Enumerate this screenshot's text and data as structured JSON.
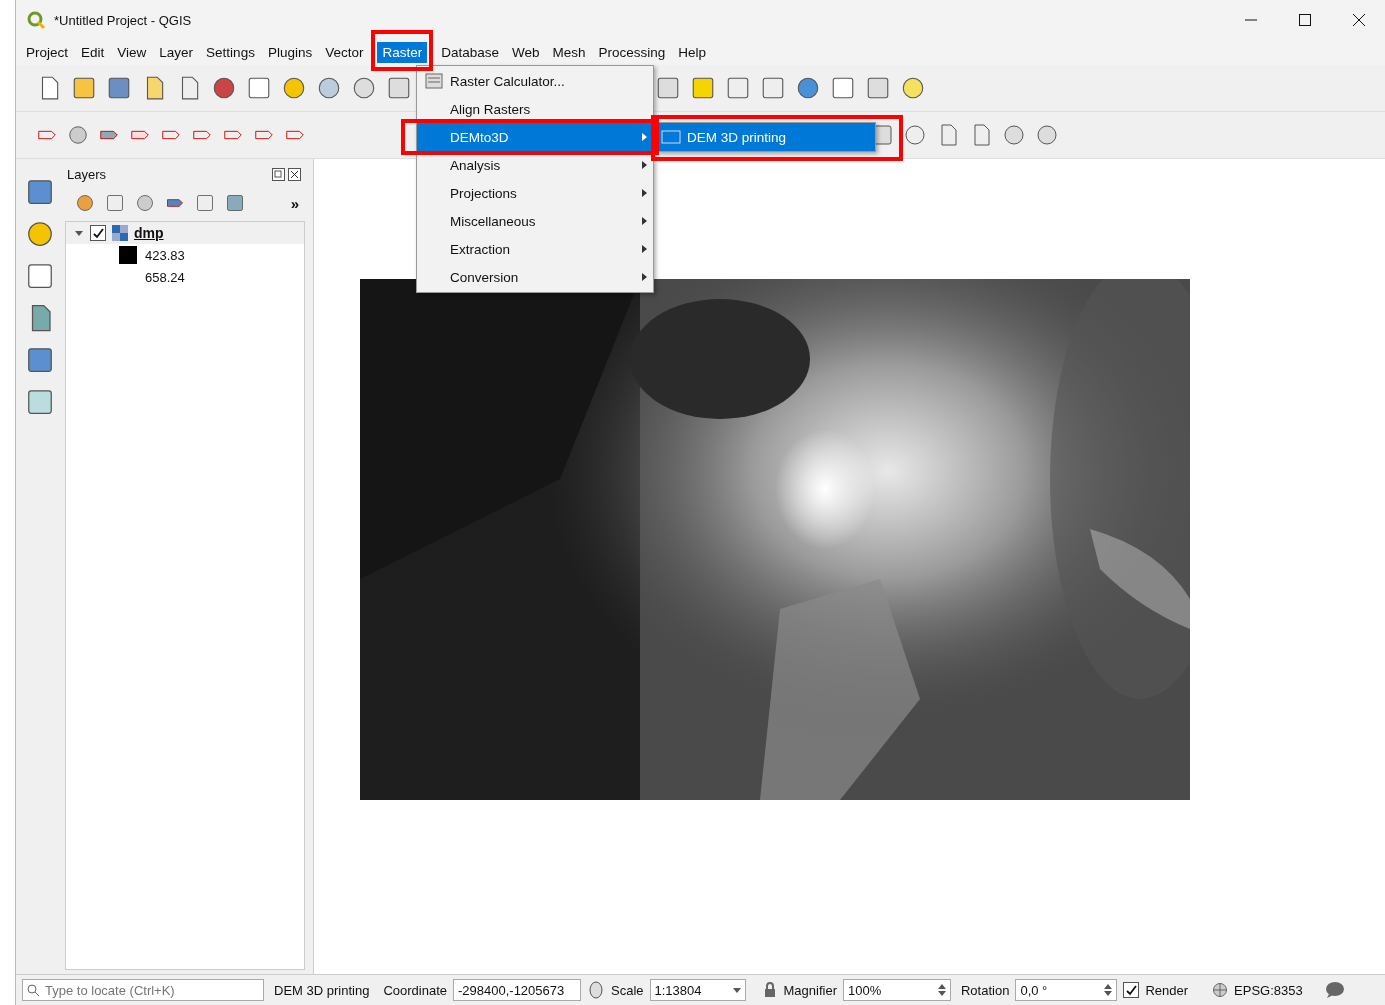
{
  "window": {
    "title": "*Untitled Project - QGIS"
  },
  "menu_bar": [
    {
      "label": "Project",
      "selected": false
    },
    {
      "label": "Edit",
      "selected": false
    },
    {
      "label": "View",
      "selected": false
    },
    {
      "label": "Layer",
      "selected": false
    },
    {
      "label": "Settings",
      "selected": false
    },
    {
      "label": "Plugins",
      "selected": false
    },
    {
      "label": "Vector",
      "selected": false
    },
    {
      "label": "Raster",
      "selected": true
    },
    {
      "label": "Database",
      "selected": false
    },
    {
      "label": "Web",
      "selected": false
    },
    {
      "label": "Mesh",
      "selected": false
    },
    {
      "label": "Processing",
      "selected": false
    },
    {
      "label": "Help",
      "selected": false
    }
  ],
  "raster_menu": [
    {
      "label": "Raster Calculator...",
      "kind": "action",
      "selected": false
    },
    {
      "label": "Align Rasters",
      "kind": "action",
      "selected": false
    },
    {
      "label": "DEMto3D",
      "kind": "submenu",
      "selected": true
    },
    {
      "label": "Analysis",
      "kind": "submenu",
      "selected": false
    },
    {
      "label": "Projections",
      "kind": "submenu",
      "selected": false
    },
    {
      "label": "Miscellaneous",
      "kind": "submenu",
      "selected": false
    },
    {
      "label": "Extraction",
      "kind": "submenu",
      "selected": false
    },
    {
      "label": "Conversion",
      "kind": "submenu",
      "selected": false
    }
  ],
  "demto3d_submenu": [
    {
      "label": "DEM 3D printing",
      "selected": true
    }
  ],
  "layers_panel": {
    "title": "Layers",
    "more": "»",
    "layers": [
      {
        "name": "dmp",
        "checked": true,
        "expanded": true,
        "legend": [
          "423.83",
          "658.24"
        ]
      }
    ]
  },
  "status_bar": {
    "locate_placeholder": "Type to locate (Ctrl+K)",
    "message": "DEM 3D printing",
    "coordinate_label": "Coordinate",
    "coordinate": "-298400,-1205673",
    "scale_label": "Scale",
    "scale": "1:13804",
    "magnifier_label": "Magnifier",
    "magnifier": "100%",
    "rotation_label": "Rotation",
    "rotation": "0,0 °",
    "render_label": "Render",
    "render_checked": true,
    "crs": "EPSG:8353"
  }
}
